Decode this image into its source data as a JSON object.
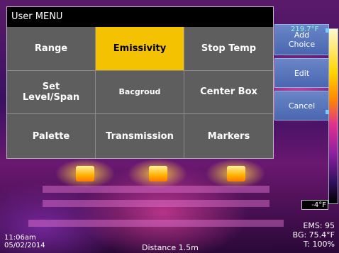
{
  "menu": {
    "title": "User MENU",
    "items": [
      {
        "label": "Range"
      },
      {
        "label": "Emissivity"
      },
      {
        "label": "Stop Temp"
      },
      {
        "label": "Set\nLevel/Span"
      },
      {
        "label": "Bacgroud"
      },
      {
        "label": "Center Box"
      },
      {
        "label": "Palette"
      },
      {
        "label": "Transmission"
      },
      {
        "label": "Markers"
      }
    ],
    "selected": "Emissivity"
  },
  "actions": {
    "add": "Add\nChoice",
    "edit": "Edit",
    "cancel": "Cancel"
  },
  "scale": {
    "top_temp": "219.7°F",
    "bottom_temp": "-4°F"
  },
  "status": {
    "ems": "EMS: 95",
    "bg": "BG: 75.4°F",
    "t": "T: 100%",
    "time": "11:06am",
    "date": "05/02/2014",
    "distance": "Distance 1.5m"
  }
}
